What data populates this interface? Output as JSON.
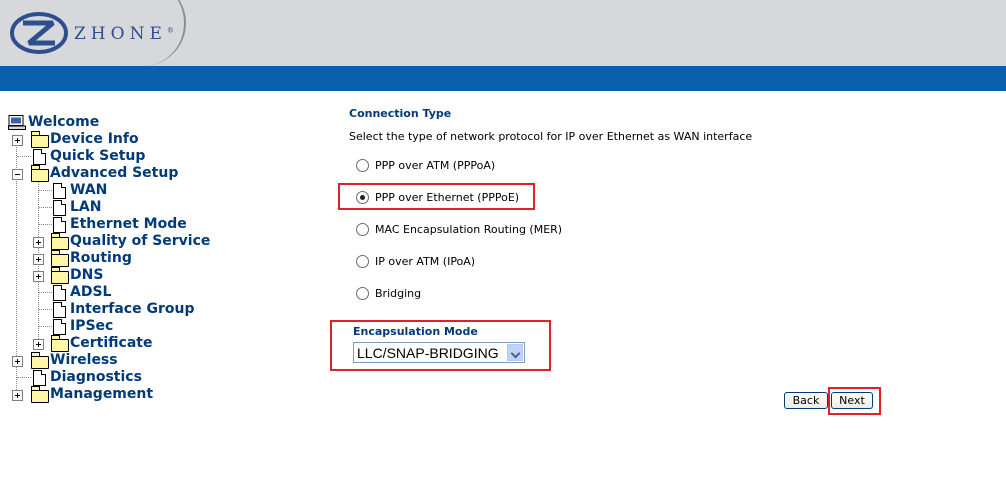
{
  "brand": {
    "logo_text": "ZHONE",
    "logo_trademark": "®"
  },
  "colors": {
    "header_bg": "#d7d8dc",
    "bluebar": "#0b5fad",
    "nav_text": "#003a7a",
    "highlight_box": "#e0202a"
  },
  "nav": {
    "welcome": "Welcome",
    "device_info": "Device Info",
    "quick_setup": "Quick Setup",
    "advanced_setup": "Advanced Setup",
    "wan": "WAN",
    "lan": "LAN",
    "ethernet_mode": "Ethernet Mode",
    "qos": "Quality of Service",
    "routing": "Routing",
    "dns": "DNS",
    "adsl": "ADSL",
    "interface_group": "Interface Group",
    "ipsec": "IPSec",
    "certificate": "Certificate",
    "wireless": "Wireless",
    "diagnostics": "Diagnostics",
    "management": "Management"
  },
  "main": {
    "section_title": "Connection Type",
    "description": "Select the type of network protocol for IP over Ethernet as WAN interface",
    "options": [
      {
        "label": "PPP over ATM (PPPoA)",
        "checked": false
      },
      {
        "label": "PPP over Ethernet (PPPoE)",
        "checked": true
      },
      {
        "label": "MAC Encapsulation Routing (MER)",
        "checked": false
      },
      {
        "label": "IP over ATM (IPoA)",
        "checked": false
      },
      {
        "label": "Bridging",
        "checked": false
      }
    ],
    "encapsulation": {
      "label": "Encapsulation Mode",
      "value": "LLC/SNAP-BRIDGING"
    },
    "back_label": "Back",
    "next_label": "Next"
  }
}
